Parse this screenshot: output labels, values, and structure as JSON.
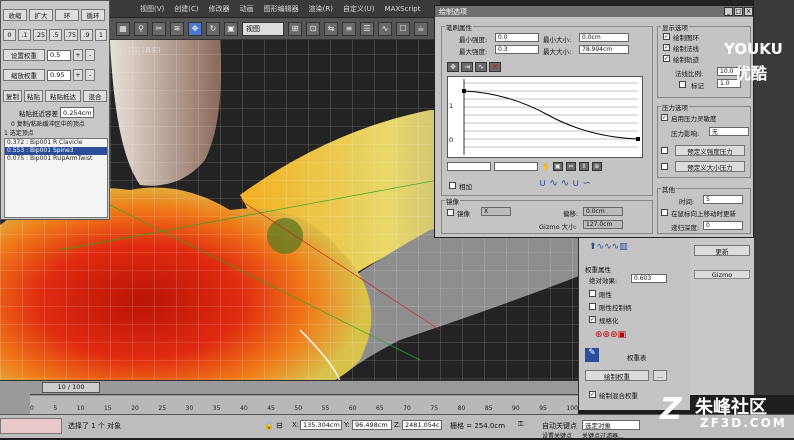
{
  "menu": {
    "items": [
      "视图(V)",
      "创建(C)",
      "修改器",
      "动画",
      "图形编辑器",
      "渲染(R)",
      "自定义(U)",
      "MAXScript"
    ]
  },
  "toolbar": {
    "view_select": "视图"
  },
  "viewport_label": "[+] [前] [真实]",
  "left_panel": {
    "row1": [
      "收缩",
      "扩大",
      "环",
      "循环"
    ],
    "row2": [
      "0",
      ".1",
      ".25",
      ".5",
      ".75",
      ".9",
      "1"
    ],
    "set_weight_label": "设置权重",
    "set_weight_value": "0.5",
    "scale_weight_label": "缩放权重",
    "scale_weight_value": "0.95",
    "row_ops": [
      "复制",
      "粘贴",
      "粘贴抵达",
      "混合"
    ],
    "paste_threshold_label": "粘贴抵近容差",
    "paste_threshold_value": "0.254cm",
    "copy_info": "0 复制/粘贴缓冲区中的顶点",
    "selected_count": "1 选定顶点",
    "vertex_list": [
      "0.372 : Bip001 R Clavicle",
      "0.553 : Bip001 Spine3",
      "0.075 : Bip001 RUpArmTwist"
    ],
    "selected_index": 1
  },
  "dialog": {
    "title": "绘制选项",
    "brush_props_title": "笔刷属性",
    "min_strength_label": "最小强度:",
    "min_strength_value": "0.0",
    "max_strength_label": "最大强度:",
    "max_strength_value": "0.3",
    "min_size_label": "最小大小:",
    "min_size_value": "0.0cm",
    "max_size_label": "最大大小:",
    "max_size_value": "78.994cm",
    "curve_axis_top": "1",
    "curve_axis_bottom": "0",
    "mirror_group_title": "镜像",
    "mirror_label": "镜像",
    "mirror_axis": "X",
    "offset_label": "偏移:",
    "offset_value": "0.0cm",
    "gizmo_size_label": "Gizmo 大小:",
    "gizmo_size_value": "127.0cm",
    "additive_label": "相加",
    "display_title": "显示选项",
    "display_opts": [
      "绘制图环",
      "绘制法线",
      "绘制轨迹"
    ],
    "normal_scale_label": "法线比例:",
    "normal_scale_value": "10.0",
    "marker_label": "标记",
    "marker_value": "1.0",
    "pressure_title": "压力选项",
    "enable_pressure_label": "启用压力灵敏度",
    "pressure_affect_label": "压力影响:",
    "pressure_affect_value": "无",
    "pred_strength_btn": "预定义强度压力",
    "pred_size_btn": "预定义大小压力",
    "misc_title": "其他",
    "interval_label": "时间:",
    "interval_value": "5",
    "update_on_release_label": "在鼠标向上移动时更新",
    "tree_depth_label": "递归深度:",
    "tree_depth_value": "0"
  },
  "command_panel": {
    "weight_props_title": "权重属性",
    "abs_effect_label": "绝对效果:",
    "abs_effect_value": "0.603",
    "rigid_label": "刚性",
    "rigid_handles_label": "刚性控制柄",
    "normalize_label": "规格化",
    "weight_table_btn": "权重表",
    "paint_weights_btn": "绘制权重",
    "paint_blend_label": "绘制混合权重",
    "update_btn": "更新",
    "gizmo_label": "Gizmo"
  },
  "timeline": {
    "frame_display": "10 / 100",
    "ticks": [
      "0",
      "5",
      "10",
      "15",
      "20",
      "25",
      "30",
      "35",
      "40",
      "45",
      "50",
      "55",
      "60",
      "65",
      "70",
      "75",
      "80",
      "85",
      "90",
      "95",
      "100"
    ]
  },
  "status": {
    "selection_text": "选择了 1 个 对象",
    "x_label": "X:",
    "x_value": "135.304cm",
    "y_label": "Y:",
    "y_value": "96.498cm",
    "z_label": "Z:",
    "z_value": "2481.054c",
    "grid_label": "栅格 = 254.0cm",
    "autokey_label": "自动关键点",
    "selected_obj": "选定对象",
    "set_key_label": "设置关键点",
    "key_filter_label": "关键点过滤器..."
  },
  "watermarks": {
    "youku_en": "YOUKU",
    "youku_cn": "优酷",
    "zhufeng_cn": "朱峰社区",
    "zhufeng_en": "ZF3D.COM"
  },
  "colors": {
    "accent_blue": "#2a4e9a",
    "skin_red": "#e02a10",
    "skin_orange": "#f28a1a",
    "skin_yellow": "#f0d020"
  }
}
